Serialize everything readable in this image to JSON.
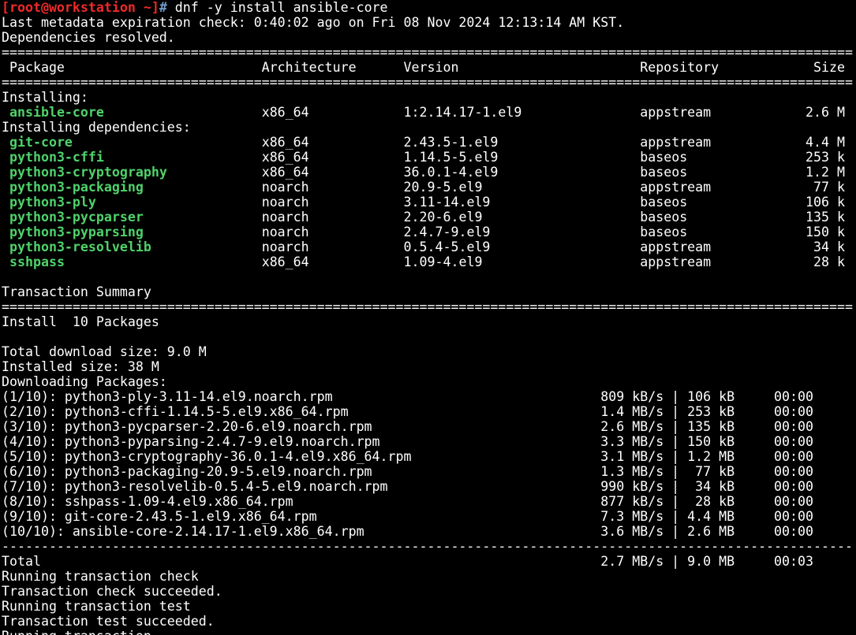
{
  "prompt": {
    "user_host": "[root@workstation ~]",
    "symbol": "#",
    "command": " dnf -y install ansible-core"
  },
  "header_lines": [
    "Last metadata expiration check: 0:40:02 ago on Fri 08 Nov 2024 12:13:14 AM KST.",
    "Dependencies resolved."
  ],
  "double_rule": "====================================================================================================================================================",
  "single_rule": "----------------------------------------------------------------------------------------------------------------------------------------------------",
  "table": {
    "columns": {
      "package": "Package",
      "arch": "Architecture",
      "version": "Version",
      "repo": "Repository",
      "size": "Size"
    },
    "installing_label": "Installing:",
    "installing": [
      {
        "name": "ansible-core",
        "arch": "x86_64",
        "version": "1:2.14.17-1.el9",
        "repo": "appstream",
        "size": "2.6 M"
      }
    ],
    "deps_label": "Installing dependencies:",
    "deps": [
      {
        "name": "git-core",
        "arch": "x86_64",
        "version": "2.43.5-1.el9",
        "repo": "appstream",
        "size": "4.4 M"
      },
      {
        "name": "python3-cffi",
        "arch": "x86_64",
        "version": "1.14.5-5.el9",
        "repo": "baseos",
        "size": "253 k"
      },
      {
        "name": "python3-cryptography",
        "arch": "x86_64",
        "version": "36.0.1-4.el9",
        "repo": "baseos",
        "size": "1.2 M"
      },
      {
        "name": "python3-packaging",
        "arch": "noarch",
        "version": "20.9-5.el9",
        "repo": "appstream",
        "size": "77 k"
      },
      {
        "name": "python3-ply",
        "arch": "noarch",
        "version": "3.11-14.el9",
        "repo": "baseos",
        "size": "106 k"
      },
      {
        "name": "python3-pycparser",
        "arch": "noarch",
        "version": "2.20-6.el9",
        "repo": "baseos",
        "size": "135 k"
      },
      {
        "name": "python3-pyparsing",
        "arch": "noarch",
        "version": "2.4.7-9.el9",
        "repo": "baseos",
        "size": "150 k"
      },
      {
        "name": "python3-resolvelib",
        "arch": "noarch",
        "version": "0.5.4-5.el9",
        "repo": "appstream",
        "size": "34 k"
      },
      {
        "name": "sshpass",
        "arch": "x86_64",
        "version": "1.09-4.el9",
        "repo": "appstream",
        "size": "28 k"
      }
    ]
  },
  "summary": {
    "title": "Transaction Summary",
    "install_line": "Install  10 Packages",
    "download_size": "Total download size: 9.0 M",
    "installed_size": "Installed size: 38 M",
    "downloading_label": "Downloading Packages:"
  },
  "downloads": [
    {
      "file": "(1/10): python3-ply-3.11-14.el9.noarch.rpm",
      "rate": "809 kB/s",
      "size": "106 kB",
      "time": "00:00"
    },
    {
      "file": "(2/10): python3-cffi-1.14.5-5.el9.x86_64.rpm",
      "rate": "1.4 MB/s",
      "size": "253 kB",
      "time": "00:00"
    },
    {
      "file": "(3/10): python3-pycparser-2.20-6.el9.noarch.rpm",
      "rate": "2.6 MB/s",
      "size": "135 kB",
      "time": "00:00"
    },
    {
      "file": "(4/10): python3-pyparsing-2.4.7-9.el9.noarch.rpm",
      "rate": "3.3 MB/s",
      "size": "150 kB",
      "time": "00:00"
    },
    {
      "file": "(5/10): python3-cryptography-36.0.1-4.el9.x86_64.rpm",
      "rate": "3.1 MB/s",
      "size": "1.2 MB",
      "time": "00:00"
    },
    {
      "file": "(6/10): python3-packaging-20.9-5.el9.noarch.rpm",
      "rate": "1.3 MB/s",
      "size": "77 kB",
      "time": "00:00"
    },
    {
      "file": "(7/10): python3-resolvelib-0.5.4-5.el9.noarch.rpm",
      "rate": "990 kB/s",
      "size": "34 kB",
      "time": "00:00"
    },
    {
      "file": "(8/10): sshpass-1.09-4.el9.x86_64.rpm",
      "rate": "877 kB/s",
      "size": "28 kB",
      "time": "00:00"
    },
    {
      "file": "(9/10): git-core-2.43.5-1.el9.x86_64.rpm",
      "rate": "7.3 MB/s",
      "size": "4.4 MB",
      "time": "00:00"
    },
    {
      "file": "(10/10): ansible-core-2.14.17-1.el9.x86_64.rpm",
      "rate": "3.6 MB/s",
      "size": "2.6 MB",
      "time": "00:00"
    }
  ],
  "total": {
    "label": "Total",
    "rate": "2.7 MB/s",
    "size": "9.0 MB",
    "time": "00:03"
  },
  "tail_lines": [
    "Running transaction check",
    "Transaction check succeeded.",
    "Running transaction test",
    "Transaction test succeeded.",
    "Running transaction"
  ],
  "colors": {
    "background": "#000000",
    "foreground": "#ffffff",
    "package_name": "#4fd26a",
    "prompt_user": "#ef2929",
    "prompt_path": "#729fcf"
  }
}
